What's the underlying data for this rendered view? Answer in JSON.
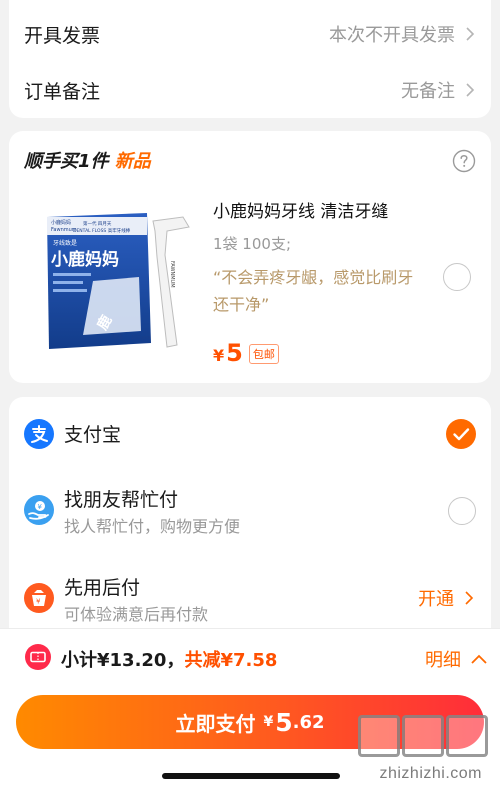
{
  "invoice": {
    "label": "开具发票",
    "value": "本次不开具发票"
  },
  "remarks": {
    "label": "订单备注",
    "value": "无备注"
  },
  "addon": {
    "header_prefix": "顺手买1件",
    "header_new": "新品",
    "product": {
      "title": "小鹿妈妈牙线 清洁牙缝",
      "spec": "1袋 100支;",
      "quote": "“不会弄疼牙龈，感觉比刷牙还干净”",
      "price_symbol": "¥",
      "price": "5",
      "badge": "包邮",
      "package_text": {
        "brand_small": "小鹿妈妈",
        "brand_en": "Fawnmum",
        "line1": "第一代 四月天",
        "line2": "DENTAL FLOSS 高牢牙线棒",
        "tag": "牙线致是",
        "big": "小鹿妈妈",
        "side": "FAWNMUM",
        "sub": "顺线",
        "count": "100 pcs",
        "extra": "鹿"
      }
    }
  },
  "payment": {
    "alipay": {
      "label": "支付宝"
    },
    "friend": {
      "label": "找朋友帮忙付",
      "sub": "找人帮忙付，购物更方便"
    },
    "later": {
      "label": "先用后付",
      "sub": "可体验满意后再付款",
      "action": "开通"
    }
  },
  "bottom": {
    "subtotal_text": "小计¥13.20，",
    "discount_text": "共减¥7.58",
    "detail_label": "明细",
    "pay_label": "立即支付",
    "pay_symbol": "¥",
    "pay_int": "5",
    "pay_dec": ".62"
  },
  "watermark": {
    "logo": "值值值",
    "url": "zhizhizhi.com"
  },
  "colors": {
    "accent": "#ff6a00",
    "price": "#ff5000",
    "quote": "#b8996a",
    "alipay": "#1677ff",
    "coupon": "#ff2a4a"
  }
}
